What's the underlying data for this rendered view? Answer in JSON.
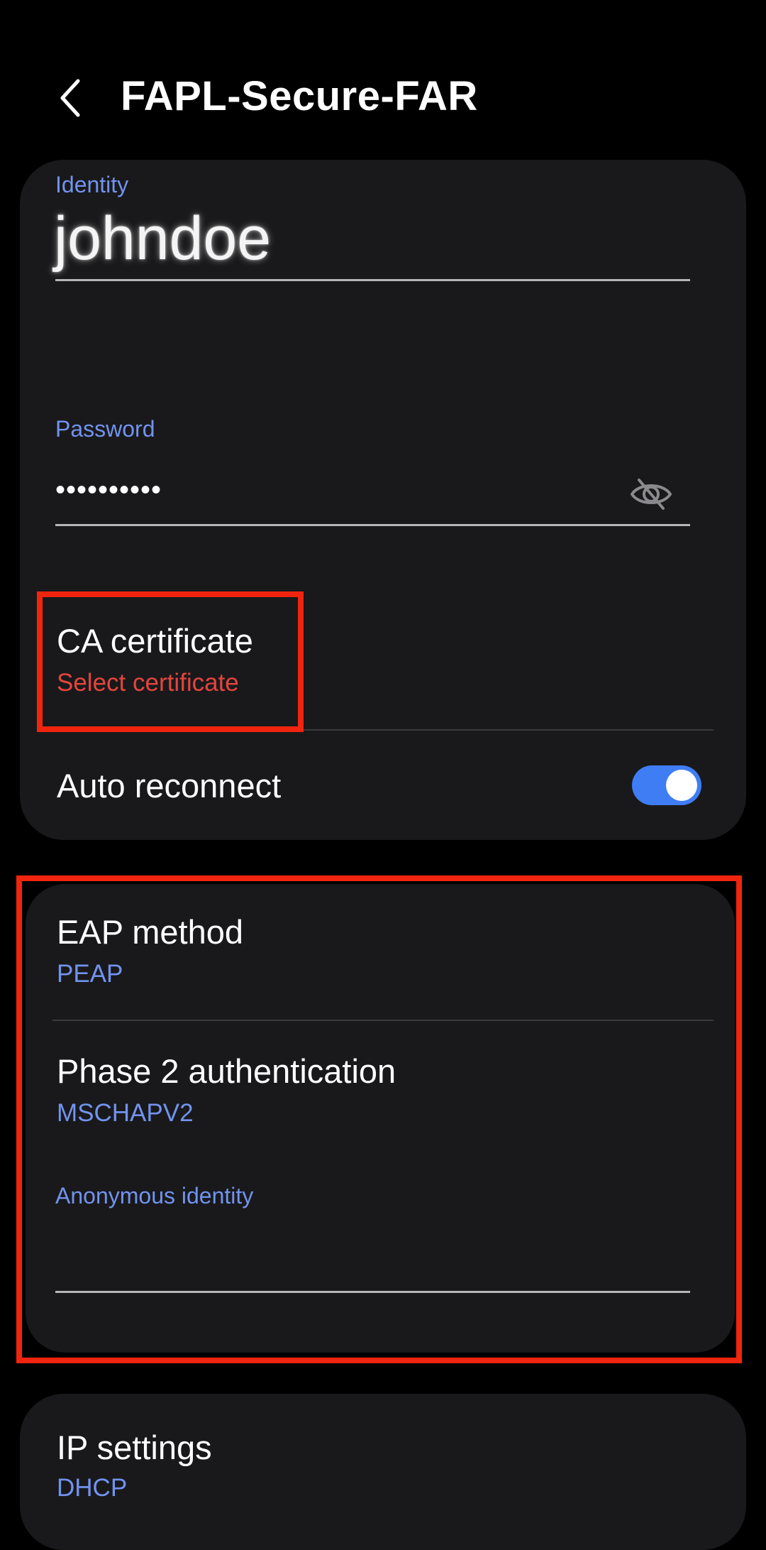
{
  "header": {
    "title": "FAPL-Secure-FAR"
  },
  "identity": {
    "label": "Identity",
    "value": "johndoe"
  },
  "password": {
    "label": "Password",
    "value": "••••••••••"
  },
  "ca_certificate": {
    "title": "CA certificate",
    "value": "Select certificate"
  },
  "auto_reconnect": {
    "title": "Auto reconnect",
    "enabled": true
  },
  "eap_method": {
    "title": "EAP method",
    "value": "PEAP"
  },
  "phase2": {
    "title": "Phase 2 authentication",
    "value": "MSCHAPV2"
  },
  "anonymous_identity": {
    "label": "Anonymous identity",
    "value": ""
  },
  "ip_settings": {
    "title": "IP settings",
    "value": "DHCP"
  },
  "colors": {
    "accent_blue": "#7293ee",
    "warning_red": "#e3453d",
    "toggle_on": "#3f7df5",
    "highlight_box": "#f1240e",
    "card_bg": "#19191b"
  },
  "icons": [
    "back-arrow-icon",
    "eye-hidden-icon"
  ]
}
